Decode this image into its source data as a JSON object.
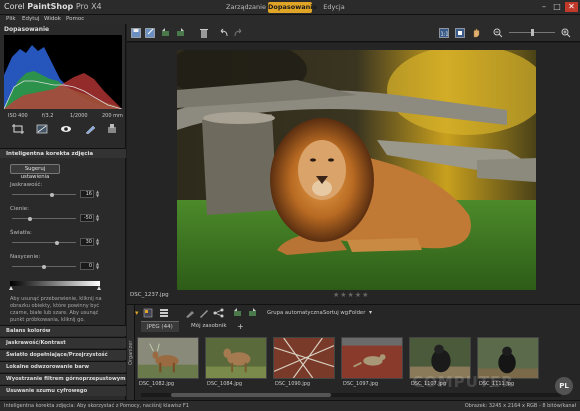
{
  "app": {
    "brand": "Corel",
    "name": "PaintShop",
    "version": "Pro X4"
  },
  "mode_tabs": [
    "Zarządzanie",
    "Dopasowanie",
    "Edycja"
  ],
  "menu": [
    "Plik",
    "Edytuj",
    "Widok",
    "Pomoc"
  ],
  "left_panel": {
    "title": "Dopasowanie",
    "exif": [
      "ISO 400",
      "f/3.2",
      "1/2000",
      "200 mm"
    ],
    "smartfix": {
      "title": "Inteligentna korekta zdjęcia",
      "suggest_button": "Sugeruj ustawienia",
      "sliders": [
        {
          "label": "Jaskrawość:",
          "value": "16",
          "fraction": 0.63
        },
        {
          "label": "Cienie:",
          "value": "-50",
          "fraction": 0.28
        },
        {
          "label": "Światła:",
          "value": "30",
          "fraction": 0.7
        },
        {
          "label": "Nasycenie:",
          "value": "0",
          "fraction": 0.5
        }
      ],
      "help": "Aby usunąć przebarwienie, kliknij na obrazku obiekty, które powinny być czarne, białe lub szare. Aby usunąć punkt próbkowania, kliknij go."
    },
    "sections": [
      "Balans kolorów",
      "Jaskrawość/Kontrast",
      "Światło dopełniające/Przejrzystość",
      "Lokalne odwzorowanie barw",
      "Wyostrzanie filtrem górnoprzepustowym",
      "Usuwanie szumu cyfrowego"
    ]
  },
  "canvas": {
    "filename": "DSC_1237.jpg",
    "stars": "★★★★★"
  },
  "organizer": {
    "side_label": "Organizer",
    "group_label": "Grupa automatyczna",
    "sort_label": "Sortuj wg:",
    "sort_value": "Folder",
    "tabs": [
      "JPEG (44)",
      "Mój zasobnik",
      "+"
    ],
    "thumbnails": [
      "DSC_1082.jpg",
      "DSC_1084.jpg",
      "DSC_1090.jpg",
      "DSC_1097.jpg",
      "DSC_1107.jpg",
      "DSC_1111.jpg"
    ]
  },
  "status": {
    "left": "Inteligentna korekta zdjęcia: Aby skorzystać z Pomocy, naciśnij klawisz F1",
    "right": "Obrazek:  3245 x 2164 x RGB - 8 bitów/kanał"
  },
  "overlay": {
    "watermark": "COMPUTER",
    "badge": "PL"
  },
  "colors": {
    "accent": "#e0a526",
    "panel": "#2a2a2a",
    "background": "#1e1e1e"
  }
}
